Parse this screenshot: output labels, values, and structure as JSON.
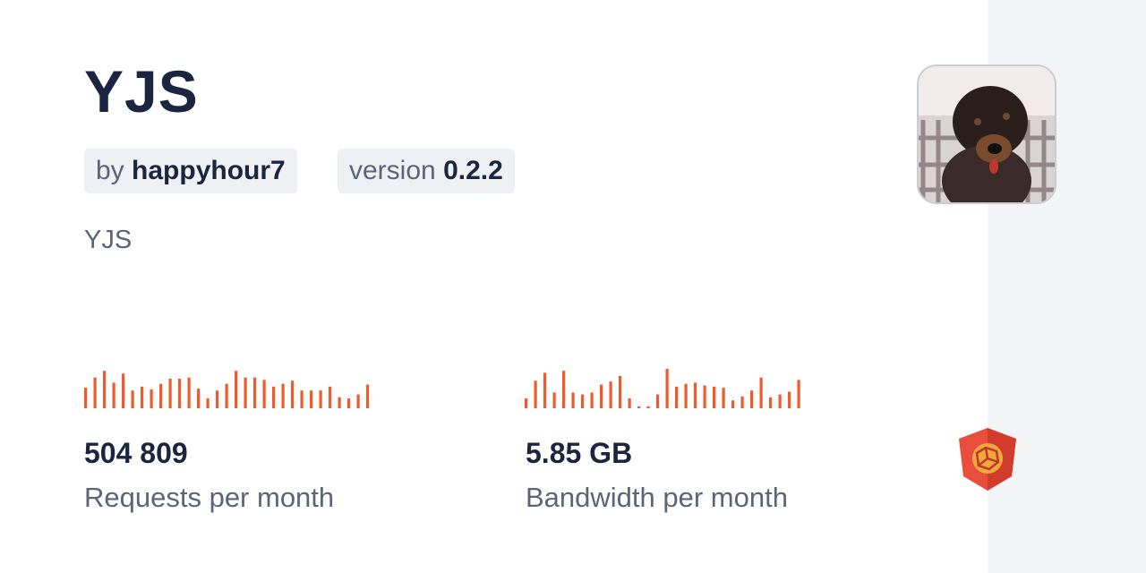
{
  "package": {
    "title": "YJS",
    "author_prefix": "by",
    "author": "happyhour7",
    "version_prefix": "version",
    "version": "0.2.2",
    "description": "YJS"
  },
  "stats": {
    "requests": {
      "value": "504 809",
      "label": "Requests per month",
      "sparkline": [
        0.52,
        0.78,
        0.95,
        0.65,
        0.88,
        0.45,
        0.55,
        0.48,
        0.62,
        0.75,
        0.75,
        0.78,
        0.5,
        0.25,
        0.45,
        0.62,
        0.95,
        0.78,
        0.78,
        0.72,
        0.55,
        0.62,
        0.7,
        0.45,
        0.45,
        0.45,
        0.55,
        0.28,
        0.25,
        0.35,
        0.6
      ]
    },
    "bandwidth": {
      "value": "5.85 GB",
      "label": "Bandwidth per month",
      "sparkline": [
        0.25,
        0.7,
        0.9,
        0.4,
        0.95,
        0.4,
        0.35,
        0.4,
        0.6,
        0.68,
        0.82,
        0.25,
        0.05,
        0.05,
        0.35,
        1.0,
        0.55,
        0.62,
        0.65,
        0.58,
        0.55,
        0.52,
        0.2,
        0.3,
        0.45,
        0.78,
        0.28,
        0.35,
        0.42,
        0.72
      ]
    }
  },
  "colors": {
    "accent": "#f05a2c",
    "title": "#1c2540",
    "muted": "#5b6478",
    "chip_bg": "#eef0f3",
    "sidebar_bg": "#f3f4f6"
  },
  "icons": {
    "avatar": "author-avatar-photo",
    "logo": "jsdelivr-logo-icon"
  }
}
